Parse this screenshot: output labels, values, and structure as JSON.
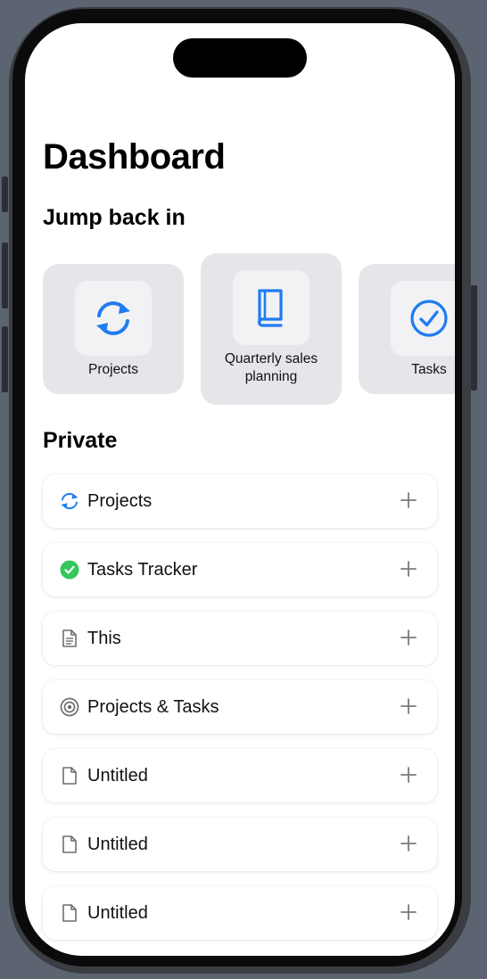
{
  "title": "Dashboard",
  "jump_back": {
    "heading": "Jump back in",
    "cards": [
      {
        "label": "Projects",
        "icon": "sync-icon"
      },
      {
        "label": "Quarterly sales planning",
        "icon": "book-icon"
      },
      {
        "label": "Tasks",
        "icon": "check-circle-icon"
      }
    ]
  },
  "private": {
    "heading": "Private",
    "items": [
      {
        "label": "Projects",
        "icon": "sync-icon"
      },
      {
        "label": "Tasks Tracker",
        "icon": "green-check-icon"
      },
      {
        "label": "This",
        "icon": "document-lines-icon"
      },
      {
        "label": "Projects & Tasks",
        "icon": "target-icon"
      },
      {
        "label": "Untitled",
        "icon": "document-icon"
      },
      {
        "label": "Untitled",
        "icon": "document-icon"
      },
      {
        "label": "Untitled",
        "icon": "document-icon"
      }
    ]
  },
  "colors": {
    "accent": "#1f7cf2",
    "success": "#34c759",
    "card_bg": "#e6e6ea",
    "background": "#5b6470"
  }
}
